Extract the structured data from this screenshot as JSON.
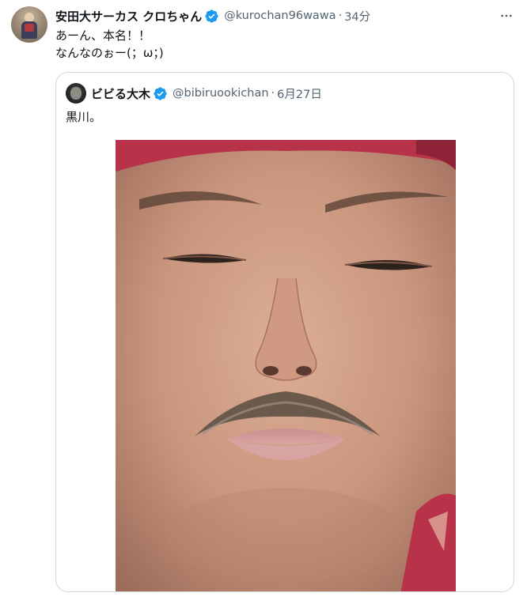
{
  "tweet": {
    "display_name": "安田大サーカス クロちゃん",
    "handle": "@kurochan96wawa",
    "separator": "·",
    "time": "34分",
    "text_lines": [
      "あーん、本名！！",
      "なんなのぉー(；ω；)"
    ]
  },
  "quoted_tweet": {
    "display_name": "ビビる大木",
    "handle": "@bibiruookichan",
    "separator": "·",
    "date": "6月27日",
    "text": "黒川。"
  },
  "icons": {
    "verified": "verified-badge-icon",
    "more": "more-options-icon"
  },
  "colors": {
    "text_primary": "#0f1419",
    "text_secondary": "#536471",
    "verified_blue": "#1d9bf0",
    "border": "#cfd9de"
  }
}
